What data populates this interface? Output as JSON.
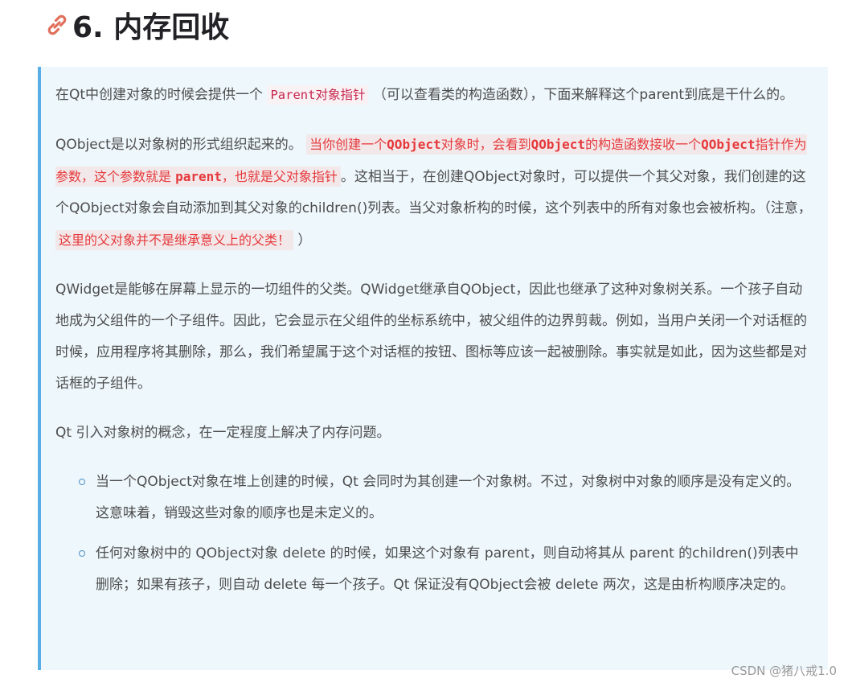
{
  "heading": {
    "number_title": "6. 内存回收",
    "icon": "link-icon"
  },
  "para1": {
    "pre": "在Qt中创建对象的时候会提供一个 ",
    "code": "Parent对象指针",
    "post": " （可以查看类的构造函数），下面来解释这个parent到底是干什么的。"
  },
  "para2": {
    "pre": "QObject是以对象树的形式组织起来的。",
    "red": {
      "a": "当你创建一个",
      "b": "QObject",
      "c": "对象时，会看到",
      "d": "QObject",
      "e": "的构造函数接收一个",
      "f": "QObject",
      "g": "指针作为参数，这个参数就是 ",
      "h": "parent",
      "i": "，也就是父对象指针"
    },
    "post": "。这相当于，在创建QObject对象时，可以提供一个其父对象，我们创建的这个QObject对象会自动添加到其父对象的children()列表。当父对象析构的时候，这个列表中的所有对象也会被析构。（注意，",
    "note": "这里的父对象并不是继承意义上的父类！",
    "end": "）"
  },
  "para3": "QWidget是能够在屏幕上显示的一切组件的父类。QWidget继承自QObject，因此也继承了这种对象树关系。一个孩子自动地成为父组件的一个子组件。因此，它会显示在父组件的坐标系统中，被父组件的边界剪裁。例如，当用户关闭一个对话框的时候，应用程序将其删除，那么，我们希望属于这个对话框的按钮、图标等应该一起被删除。事实就是如此，因为这些都是对话框的子组件。",
  "para4": "Qt 引入对象树的概念，在一定程度上解决了内存问题。",
  "points": [
    "当一个QObject对象在堆上创建的时候，Qt 会同时为其创建一个对象树。不过，对象树中对象的顺序是没有定义的。这意味着，销毁这些对象的顺序也是未定义的。",
    "任何对象树中的 QObject对象 delete 的时候，如果这个对象有 parent，则自动将其从 parent 的children()列表中删除；如果有孩子，则自动 delete 每一个孩子。Qt 保证没有QObject会被 delete 两次，这是由析构顺序决定的。"
  ],
  "watermark": "CSDN @猪八戒1.0",
  "colors": {
    "accent_border": "#5aaee6",
    "quote_bg": "#eef7fc",
    "code_red": "#c7254e",
    "note_red": "#e6393b"
  }
}
